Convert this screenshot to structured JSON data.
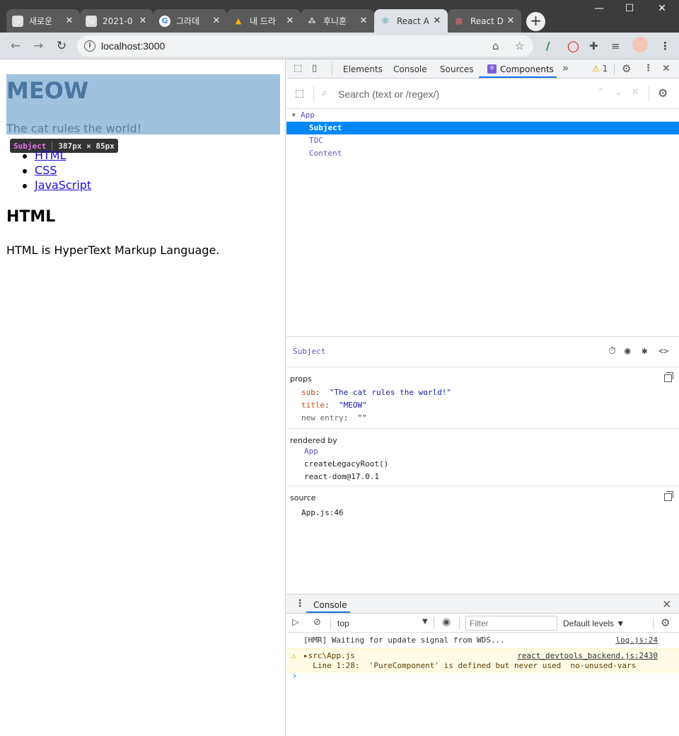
{
  "browser": {
    "tabs": [
      {
        "title": "새로운",
        "fav": "😺",
        "fav_bg": "#e0e0e0"
      },
      {
        "title": "2021-0",
        "fav": "😺",
        "fav_bg": "#e0e0e0"
      },
      {
        "title": "그라데",
        "fav": "G",
        "fav_bg": "#ffffff"
      },
      {
        "title": "내 드라",
        "fav": "▲",
        "fav_bg": "transparent"
      },
      {
        "title": "후니훈",
        "fav": "⁂",
        "fav_bg": "transparent"
      },
      {
        "title": "React A",
        "fav": "⚛",
        "fav_bg": "transparent"
      },
      {
        "title": "React D",
        "fav": "▦",
        "fav_bg": "transparent"
      }
    ],
    "url": "localhost:3000"
  },
  "page": {
    "title": "MEOW",
    "tagline": "The cat rules the world!",
    "toc": [
      "HTML",
      "CSS",
      "JavaScript"
    ],
    "content_title": "HTML",
    "content_desc": "HTML is HyperText Markup Language.",
    "inspect_tip": {
      "name": "Subject",
      "dims": "387px × 85px"
    }
  },
  "devtools": {
    "tabs": [
      "Elements",
      "Console",
      "Sources",
      "Components"
    ],
    "active_tab": "Components",
    "warning_count": "1",
    "search_placeholder": "Search (text or /regex/)",
    "tree": [
      {
        "label": "App",
        "depth": 0,
        "selected": false,
        "expanded": true
      },
      {
        "label": "Subject",
        "depth": 1,
        "selected": true
      },
      {
        "label": "TOC",
        "depth": 1,
        "selected": false
      },
      {
        "label": "Content",
        "depth": 1,
        "selected": false
      }
    ],
    "inspector": {
      "component": "Subject",
      "props_title": "props",
      "props": [
        {
          "key": "sub",
          "value": "\"The cat rules the world!\""
        },
        {
          "key": "title",
          "value": "\"MEOW\""
        },
        {
          "key": "new entry",
          "value": "\"\""
        }
      ],
      "rendered_by_title": "rendered by",
      "rendered_by": [
        "App",
        "createLegacyRoot()",
        "react-dom@17.0.1"
      ],
      "source_title": "source",
      "source": "App.js:46"
    }
  },
  "console": {
    "tab": "Console",
    "context": "top",
    "filter_placeholder": "Filter",
    "levels": "Default levels ▼",
    "messages": [
      {
        "text": "[HMR] Waiting for update signal from WDS...",
        "src": "log.js:24",
        "level": "info"
      },
      {
        "text": "▸src\\App.js",
        "line2": "  Line 1:28:  'PureComponent' is defined but never used  no-unused-vars",
        "src": "react_devtools_backend.js:2430",
        "level": "warning"
      }
    ],
    "prompt": "›"
  }
}
